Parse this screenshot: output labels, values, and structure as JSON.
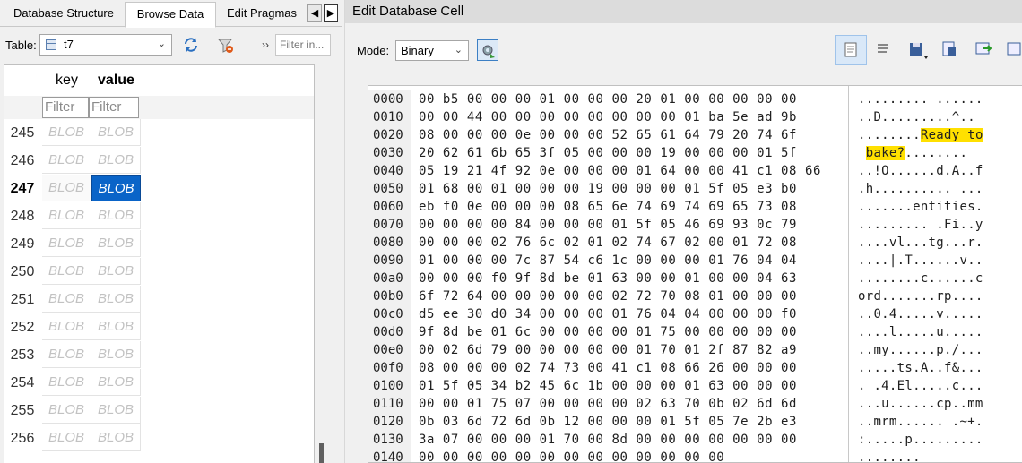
{
  "left_tabs": [
    "Database Structure",
    "Browse Data",
    "Edit Pragmas"
  ],
  "active_tab": "Browse Data",
  "table_label": "Table:",
  "table_name": "t7",
  "filter_placeholder": "Filter in...",
  "columns": [
    "key",
    "value"
  ],
  "column_filter_placeholder": "Filter",
  "rows": [
    {
      "num": "245",
      "key": "BLOB",
      "value": "BLOB"
    },
    {
      "num": "246",
      "key": "BLOB",
      "value": "BLOB"
    },
    {
      "num": "247",
      "key": "BLOB",
      "value": "BLOB",
      "selected": true
    },
    {
      "num": "248",
      "key": "BLOB",
      "value": "BLOB"
    },
    {
      "num": "249",
      "key": "BLOB",
      "value": "BLOB"
    },
    {
      "num": "250",
      "key": "BLOB",
      "value": "BLOB"
    },
    {
      "num": "251",
      "key": "BLOB",
      "value": "BLOB"
    },
    {
      "num": "252",
      "key": "BLOB",
      "value": "BLOB"
    },
    {
      "num": "253",
      "key": "BLOB",
      "value": "BLOB"
    },
    {
      "num": "254",
      "key": "BLOB",
      "value": "BLOB"
    },
    {
      "num": "255",
      "key": "BLOB",
      "value": "BLOB"
    },
    {
      "num": "256",
      "key": "BLOB",
      "value": "BLOB"
    }
  ],
  "edit_cell": {
    "title": "Edit Database Cell",
    "mode_label": "Mode:",
    "mode_value": "Binary",
    "highlight_color": "#ffe000",
    "hex_lines": [
      {
        "off": "0000",
        "bytes": "00 b5 00 00 00 01 00 00 00 20 01 00 00 00 00 00",
        "ascii": "......... ......"
      },
      {
        "off": "0010",
        "bytes": "00 00 44 00 00 00 00 00 00 00 00 01 ba 5e ad 9b",
        "ascii": "..D.........^.."
      },
      {
        "off": "0020",
        "bytes": "08 00 00 00 0e 00 00 00 52 65 61 64 79 20 74 6f",
        "ascii": "........Ready to",
        "hl_start": 8,
        "hl_end": 16
      },
      {
        "off": "0030",
        "bytes": "20 62 61 6b 65 3f 05 00 00 00 19 00 00 00 01 5f",
        "ascii": " bake?........",
        "hl_start": 1,
        "hl_end": 6
      },
      {
        "off": "0040",
        "bytes": "05 19 21 4f 92 0e 00 00 00 01 64 00 00 41 c1 08 66",
        "ascii": "..!O......d.A..f"
      },
      {
        "off": "0050",
        "bytes": "01 68 00 01 00 00 00 19 00 00 00 01 5f 05 e3 b0",
        "ascii": ".h.......... ..."
      },
      {
        "off": "0060",
        "bytes": "eb f0 0e 00 00 00 08 65 6e 74 69 74 69 65 73 08",
        "ascii": ".......entities."
      },
      {
        "off": "0070",
        "bytes": "00 00 00 00 84 00 00 00 01 5f 05 46 69 93 0c 79",
        "ascii": "......... .Fi..y"
      },
      {
        "off": "0080",
        "bytes": "00 00 00 02 76 6c 02 01 02 74 67 02 00 01 72 08",
        "ascii": "....vl...tg...r."
      },
      {
        "off": "0090",
        "bytes": "01 00 00 00 7c 87 54 c6 1c 00 00 00 01 76 04 04",
        "ascii": "....|.T......v.."
      },
      {
        "off": "00a0",
        "bytes": "00 00 00 f0 9f 8d be 01 63 00 00 01 00 00 04 63",
        "ascii": "........c......c"
      },
      {
        "off": "00b0",
        "bytes": "6f 72 64 00 00 00 00 00 02 72 70 08 01 00 00 00",
        "ascii": "ord.......rp...."
      },
      {
        "off": "00c0",
        "bytes": "d5 ee 30 d0 34 00 00 00 01 76 04 04 00 00 00 f0",
        "ascii": "..0.4.....v....."
      },
      {
        "off": "00d0",
        "bytes": "9f 8d be 01 6c 00 00 00 00 01 75 00 00 00 00 00",
        "ascii": "....l.....u....."
      },
      {
        "off": "00e0",
        "bytes": "00 02 6d 79 00 00 00 00 00 01 70 01 2f 87 82 a9",
        "ascii": "..my......p./..."
      },
      {
        "off": "00f0",
        "bytes": "08 00 00 00 02 74 73 00 41 c1 08 66 26 00 00 00",
        "ascii": ".....ts.A..f&..."
      },
      {
        "off": "0100",
        "bytes": "01 5f 05 34 b2 45 6c 1b 00 00 00 01 63 00 00 00",
        "ascii": ". .4.El.....c..."
      },
      {
        "off": "0110",
        "bytes": "00 00 01 75 07 00 00 00 00 02 63 70 0b 02 6d 6d",
        "ascii": "...u......cp..mm"
      },
      {
        "off": "0120",
        "bytes": "0b 03 6d 72 6d 0b 12 00 00 00 01 5f 05 7e 2b e3",
        "ascii": "..mrm...... .~+."
      },
      {
        "off": "0130",
        "bytes": "3a 07 00 00 00 01 70 00 8d 00 00 00 00 00 00 00",
        "ascii": ":.....p........."
      },
      {
        "off": "0140",
        "bytes": "00 00 00 00 00 00 00 00 00 00 00 00 00",
        "ascii": "........"
      }
    ]
  }
}
